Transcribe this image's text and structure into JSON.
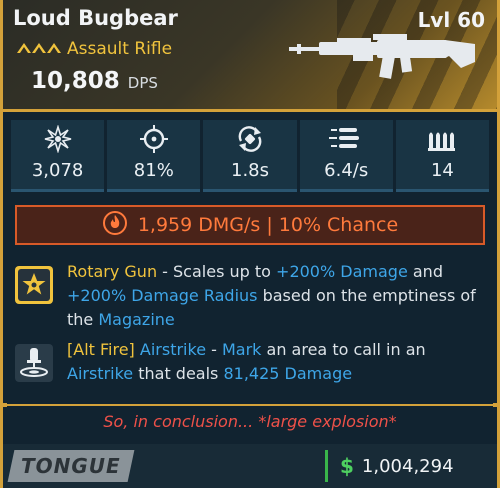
{
  "item": {
    "name": "Loud Bugbear",
    "level": "Lvl 60",
    "type": "Assault Rifle",
    "dps_value": "10,808",
    "dps_unit": "DPS"
  },
  "stats": [
    {
      "icon": "burst-icon",
      "value": "3,078"
    },
    {
      "icon": "crosshair-icon",
      "value": "81%"
    },
    {
      "icon": "reload-icon",
      "value": "1.8s"
    },
    {
      "icon": "fire-rate-icon",
      "value": "6.4/s"
    },
    {
      "icon": "ammo-icon",
      "value": "14"
    }
  ],
  "elemental": {
    "icon": "fire-icon",
    "text": "1,959 DMG/s | 10% Chance"
  },
  "perks": [
    {
      "icon": "star-badge-icon",
      "name": "Rotary Gun",
      "t1": " - Scales up to ",
      "h1": "+200% Damage",
      "t2": " and ",
      "h2": "+200% Damage Radius",
      "t3": " based on the emptiness of the ",
      "h3": "Magazine"
    },
    {
      "icon": "airstrike-icon",
      "name": "[Alt Fire]",
      "t0": " ",
      "h0": "Airstrike",
      "t1": " - ",
      "h1": "Mark",
      "t2": " an area to call in an ",
      "h2": "Airstrike",
      "t3": " that deals ",
      "h3": "81,425 Damage"
    }
  ],
  "flavor_text": "So, in conclusion... *large explosion*",
  "footer": {
    "brand": "TONGUE",
    "currency_symbol": "$",
    "price": "1,004,294"
  },
  "colors": {
    "rarity_gold": "#d3a13a",
    "type_yellow": "#f0c33d",
    "highlight_blue": "#3ea6e8",
    "fire_orange": "#ff7a3c",
    "flavor_red": "#ee5149",
    "money_green": "#4ed060"
  }
}
